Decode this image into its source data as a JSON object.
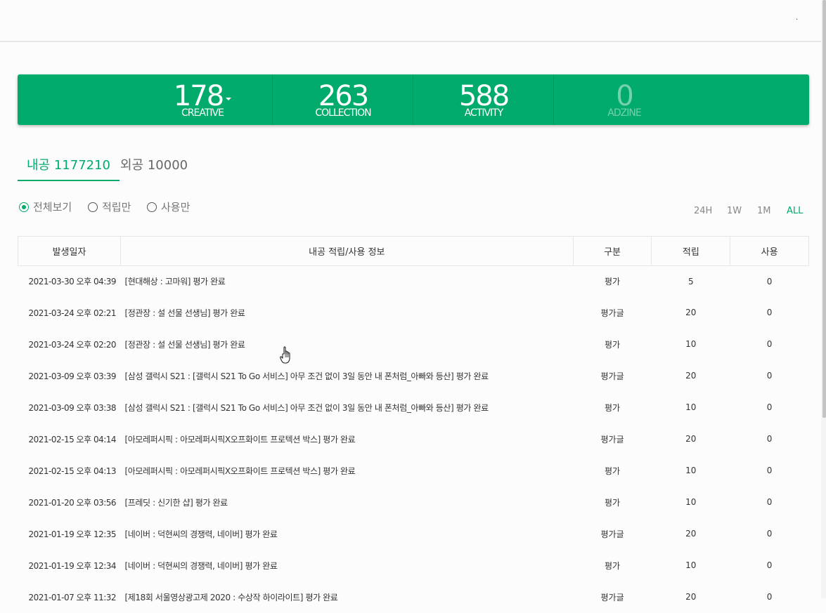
{
  "topbar": {
    "dot": "."
  },
  "stats": [
    {
      "value": "178",
      "label": "CREATIVE",
      "has_dropdown": true
    },
    {
      "value": "263",
      "label": "COLLECTION"
    },
    {
      "value": "588",
      "label": "ACTIVITY"
    },
    {
      "value": "0",
      "label": "ADZINE",
      "dimmed": true
    }
  ],
  "tabs": {
    "internal": "내공 1177210",
    "external": "외공 10000"
  },
  "filters": {
    "all": "전체보기",
    "earned_only": "적립만",
    "used_only": "사용만",
    "selected": "전체보기"
  },
  "periods": {
    "p24h": "24H",
    "p1w": "1W",
    "p1m": "1M",
    "all": "ALL",
    "selected": "ALL"
  },
  "table": {
    "headers": {
      "date": "발생일자",
      "info": "내공 적립/사용 정보",
      "type": "구분",
      "earn": "적립",
      "use": "사용"
    },
    "rows": [
      {
        "date": "2021-03-30 오후 04:39",
        "info": "[현대해상 : 고마워] 평가 완료",
        "type": "평가",
        "earn": "5",
        "use": "0"
      },
      {
        "date": "2021-03-24 오후 02:21",
        "info": "[정관장 : 설 선물 선생님] 평가 완료",
        "type": "평가글",
        "earn": "20",
        "use": "0"
      },
      {
        "date": "2021-03-24 오후 02:20",
        "info": "[정관장 : 설 선물 선생님] 평가 완료",
        "type": "평가",
        "earn": "10",
        "use": "0"
      },
      {
        "date": "2021-03-09 오후 03:39",
        "info": "[삼성 갤럭시 S21 : [갤럭시 S21 To Go 서비스] 아무 조건 없이 3일 동안 내 폰처럼_아빠와 등산] 평가 완료",
        "type": "평가글",
        "earn": "20",
        "use": "0"
      },
      {
        "date": "2021-03-09 오후 03:38",
        "info": "[삼성 갤럭시 S21 : [갤럭시 S21 To Go 서비스] 아무 조건 없이 3일 동안 내 폰처럼_아빠와 등산] 평가 완료",
        "type": "평가",
        "earn": "10",
        "use": "0"
      },
      {
        "date": "2021-02-15 오후 04:14",
        "info": "[아모레퍼시픽 : 아모레퍼시픽X오프화이트 프로텍션 박스] 평가 완료",
        "type": "평가글",
        "earn": "20",
        "use": "0"
      },
      {
        "date": "2021-02-15 오후 04:13",
        "info": "[아모레퍼시픽 : 아모레퍼시픽X오프화이트 프로텍션 박스] 평가 완료",
        "type": "평가",
        "earn": "10",
        "use": "0"
      },
      {
        "date": "2021-01-20 오후 03:56",
        "info": "[프레딧 : 신기한 샵] 평가 완료",
        "type": "평가",
        "earn": "10",
        "use": "0"
      },
      {
        "date": "2021-01-19 오후 12:35",
        "info": "[네이버 : 덕현씨의 경쟁력, 네이버] 평가 완료",
        "type": "평가글",
        "earn": "20",
        "use": "0"
      },
      {
        "date": "2021-01-19 오후 12:34",
        "info": "[네이버 : 덕현씨의 경쟁력, 네이버] 평가 완료",
        "type": "평가",
        "earn": "10",
        "use": "0"
      },
      {
        "date": "2021-01-07 오후 11:32",
        "info": "[제18회 서울영상광고제 2020 : 수상작 하이라이트] 평가 완료",
        "type": "평가글",
        "earn": "20",
        "use": "0"
      }
    ]
  },
  "colors": {
    "brand_green": "#00ab6b",
    "earn_blue": "#2a86c9",
    "use_red": "#e8473b"
  },
  "cursor_icon": "hand-pointer-icon"
}
